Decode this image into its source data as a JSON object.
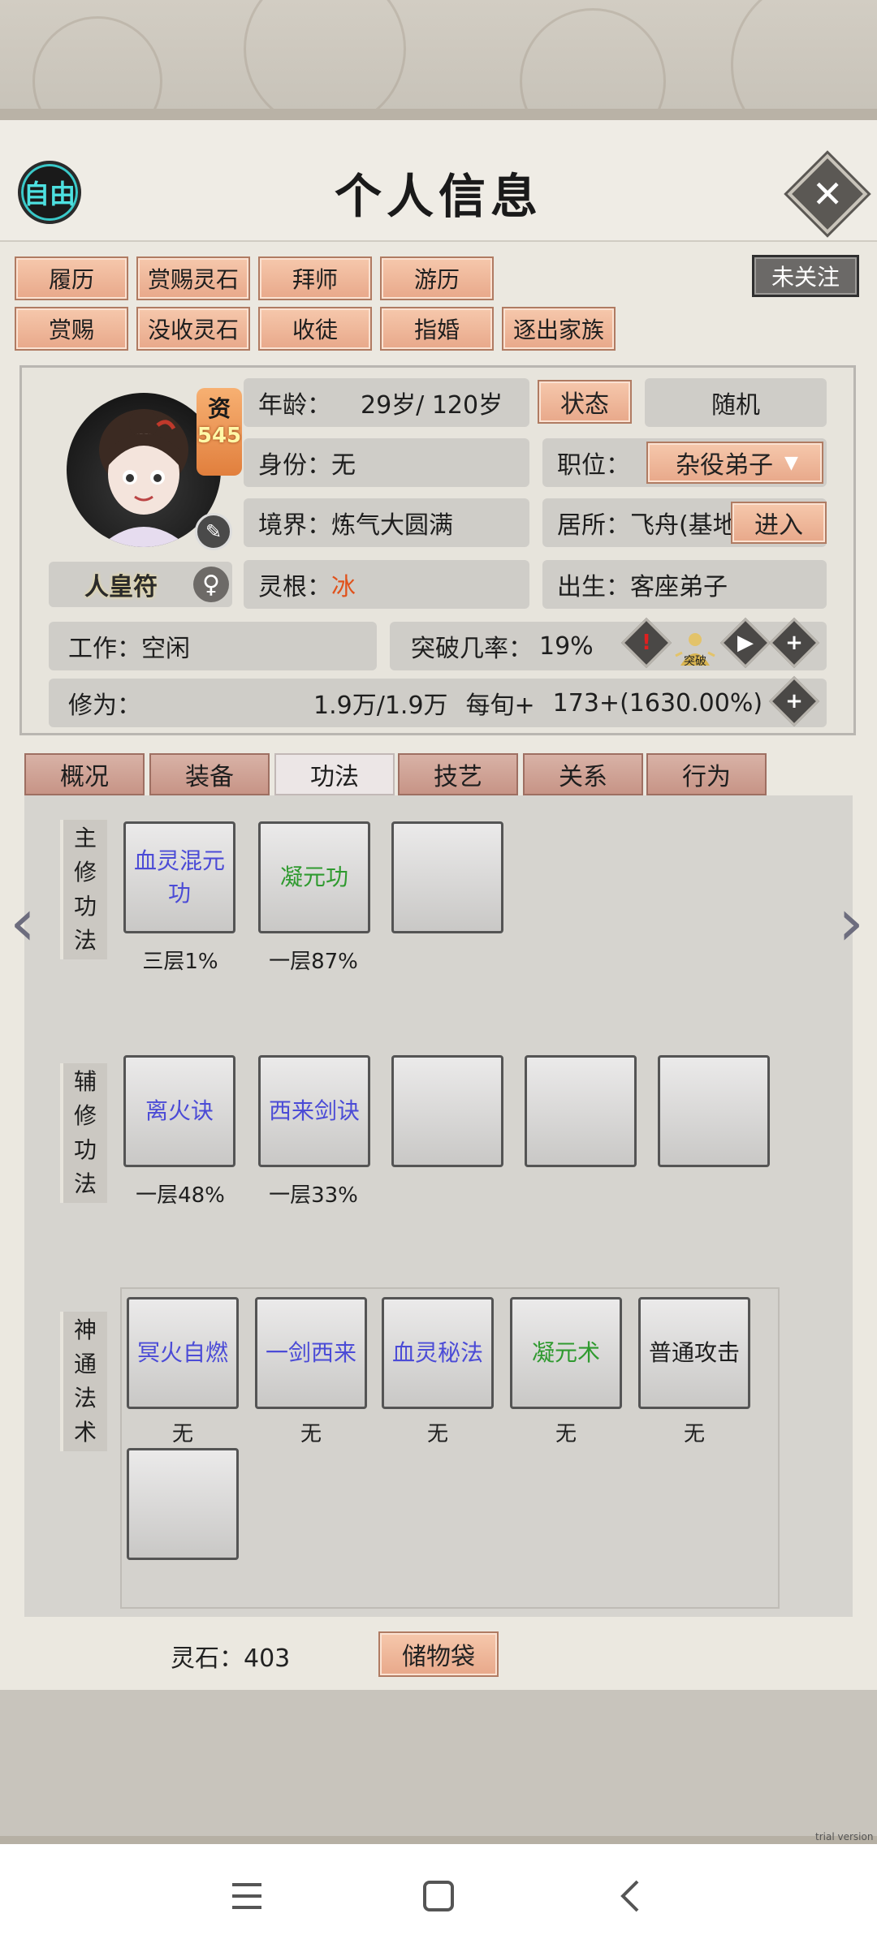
{
  "header": {
    "free_label": "自由",
    "title": "个人信息",
    "close_icon": "close-icon"
  },
  "actions": {
    "row1": [
      "履历",
      "赏赐灵石",
      "拜师",
      "游历"
    ],
    "row2": [
      "赏赐",
      "没收灵石",
      "收徒",
      "指婚",
      "逐出家族"
    ],
    "follow": "未关注"
  },
  "profile": {
    "aptitude_label": "资",
    "aptitude_value": "545",
    "name": "人皇符",
    "age_label": "年龄：",
    "age_value": "29岁/ 120岁",
    "status_btn": "状态",
    "random_btn": "随机",
    "identity_label": "身份：",
    "identity_value": "无",
    "position_label": "职位：",
    "position_value": "杂役弟子",
    "realm_label": "境界：",
    "realm_value": "炼气大圆满",
    "residence_label": "居所：",
    "residence_value": "飞舟(基地",
    "enter_btn": "进入",
    "root_label": "灵根：",
    "root_value": "冰",
    "root_color": "#e0521c",
    "birth_label": "出生：",
    "birth_value": "客座弟子",
    "work_label": "工作：",
    "work_value": "空闲",
    "breakthrough_label": "突破几率：",
    "breakthrough_value": "19%",
    "cultivation_label": "修为：",
    "cultivation_value": "1.9万/1.9万",
    "per_turn_label": "每旬+",
    "per_turn_value": "173+(1630.00%)",
    "breakthrough_badge": "突破"
  },
  "tabs": [
    "概况",
    "装备",
    "功法",
    "技艺",
    "关系",
    "行为"
  ],
  "active_tab": "功法",
  "main_methods": {
    "label": "主修功法",
    "slots": [
      {
        "name": "血灵混元功",
        "level": "三层1%",
        "color": "blue"
      },
      {
        "name": "凝元功",
        "level": "一层87%",
        "color": "green"
      },
      {
        "name": "",
        "level": ""
      }
    ]
  },
  "aux_methods": {
    "label": "辅修功法",
    "slots": [
      {
        "name": "离火诀",
        "level": "一层48%",
        "color": "blue"
      },
      {
        "name": "西来剑诀",
        "level": "一层33%",
        "color": "blue"
      },
      {
        "name": "",
        "level": ""
      },
      {
        "name": "",
        "level": ""
      },
      {
        "name": "",
        "level": ""
      }
    ]
  },
  "spells": {
    "label": "神通法术",
    "slots": [
      {
        "name": "冥火自燃",
        "level": "无",
        "color": "blue"
      },
      {
        "name": "一剑西来",
        "level": "无",
        "color": "blue"
      },
      {
        "name": "血灵秘法",
        "level": "无",
        "color": "blue"
      },
      {
        "name": "凝元术",
        "level": "无",
        "color": "green"
      },
      {
        "name": "普通攻击",
        "level": "无",
        "color": "black"
      },
      {
        "name": "",
        "level": ""
      }
    ]
  },
  "footer": {
    "spirit_stone": "灵石：403",
    "bag_btn": "储物袋",
    "watermark": "trial version"
  },
  "navbar": {
    "menu_icon": "menu-icon",
    "home_icon": "home-icon",
    "back_icon": "back-icon"
  }
}
